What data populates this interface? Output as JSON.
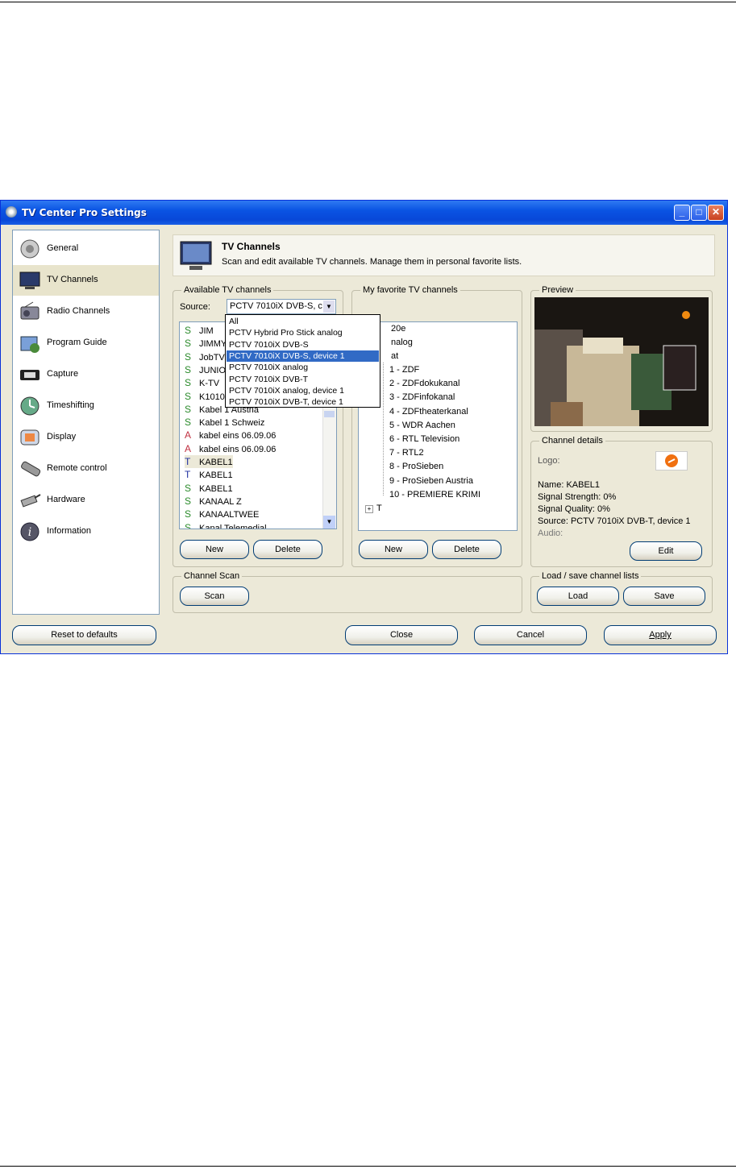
{
  "window": {
    "title": "TV Center Pro Settings"
  },
  "sidebar": {
    "items": [
      {
        "label": "General"
      },
      {
        "label": "TV Channels"
      },
      {
        "label": "Radio Channels"
      },
      {
        "label": "Program Guide"
      },
      {
        "label": "Capture"
      },
      {
        "label": "Timeshifting"
      },
      {
        "label": "Display"
      },
      {
        "label": "Remote control"
      },
      {
        "label": "Hardware"
      },
      {
        "label": "Information"
      }
    ]
  },
  "header": {
    "title": "TV Channels",
    "subtitle": "Scan and edit available TV channels. Manage them in personal favorite lists."
  },
  "available": {
    "label": "Available TV channels",
    "source_label": "Source:",
    "source_value": "PCTV 7010iX DVB-S, c",
    "channels": [
      {
        "type": "S",
        "name": "JIM"
      },
      {
        "type": "S",
        "name": "JIMMY"
      },
      {
        "type": "S",
        "name": "JobTV"
      },
      {
        "type": "S",
        "name": "JUNIO"
      },
      {
        "type": "S",
        "name": "K-TV"
      },
      {
        "type": "S",
        "name": "K1010"
      },
      {
        "type": "S",
        "name": "Kabel 1 Austria"
      },
      {
        "type": "S",
        "name": "Kabel 1 Schweiz"
      },
      {
        "type": "A",
        "name": "kabel eins 06.09.06"
      },
      {
        "type": "A",
        "name": "kabel eins 06.09.06"
      },
      {
        "type": "T",
        "name": "KABEL1"
      },
      {
        "type": "T",
        "name": "KABEL1"
      },
      {
        "type": "S",
        "name": "KABEL1"
      },
      {
        "type": "S",
        "name": "KANAAL Z"
      },
      {
        "type": "S",
        "name": "KANAALTWEE"
      },
      {
        "type": "S",
        "name": "Kanal Telemedial"
      }
    ],
    "new_label": "New",
    "delete_label": "Delete"
  },
  "source_dropdown": {
    "options": [
      "All",
      "PCTV Hybrid Pro Stick analog",
      "PCTV 7010iX DVB-S",
      "PCTV 7010iX DVB-S, device 1",
      "PCTV 7010iX analog",
      "PCTV 7010iX DVB-T",
      "PCTV 7010iX analog, device 1",
      "PCTV 7010iX DVB-T, device 1"
    ],
    "selected_index": 3
  },
  "favorites": {
    "label": "My favorite TV channels",
    "groups": [
      "20e",
      "nalog",
      "at"
    ],
    "channels": [
      "1 - ZDF",
      "2 - ZDFdokukanal",
      "3 - ZDFinfokanal",
      "4 - ZDFtheaterkanal",
      "5 - WDR Aachen",
      "6 - RTL Television",
      "7 - RTL2",
      "8 - ProSieben",
      "9 - ProSieben Austria",
      "10 - PREMIERE KRIMI"
    ],
    "last_group": "T",
    "new_label": "New",
    "delete_label": "Delete"
  },
  "preview": {
    "label": "Preview"
  },
  "details": {
    "label": "Channel details",
    "logo_label": "Logo:",
    "name": "Name: KABEL1",
    "strength": "Signal Strength: 0%",
    "quality": "Signal Quality: 0%",
    "source": "Source: PCTV 7010iX DVB-T, device 1",
    "audio": "Audio:",
    "edit_label": "Edit"
  },
  "scan": {
    "label": "Channel Scan",
    "button": "Scan"
  },
  "lists": {
    "label": "Load / save channel lists",
    "load": "Load",
    "save": "Save"
  },
  "footer": {
    "reset": "Reset to defaults",
    "close": "Close",
    "cancel": "Cancel",
    "apply": "Apply"
  },
  "colors": {
    "titlebar": "#0a54e3",
    "selection": "#316ac5",
    "window_bg": "#ece9d8"
  }
}
